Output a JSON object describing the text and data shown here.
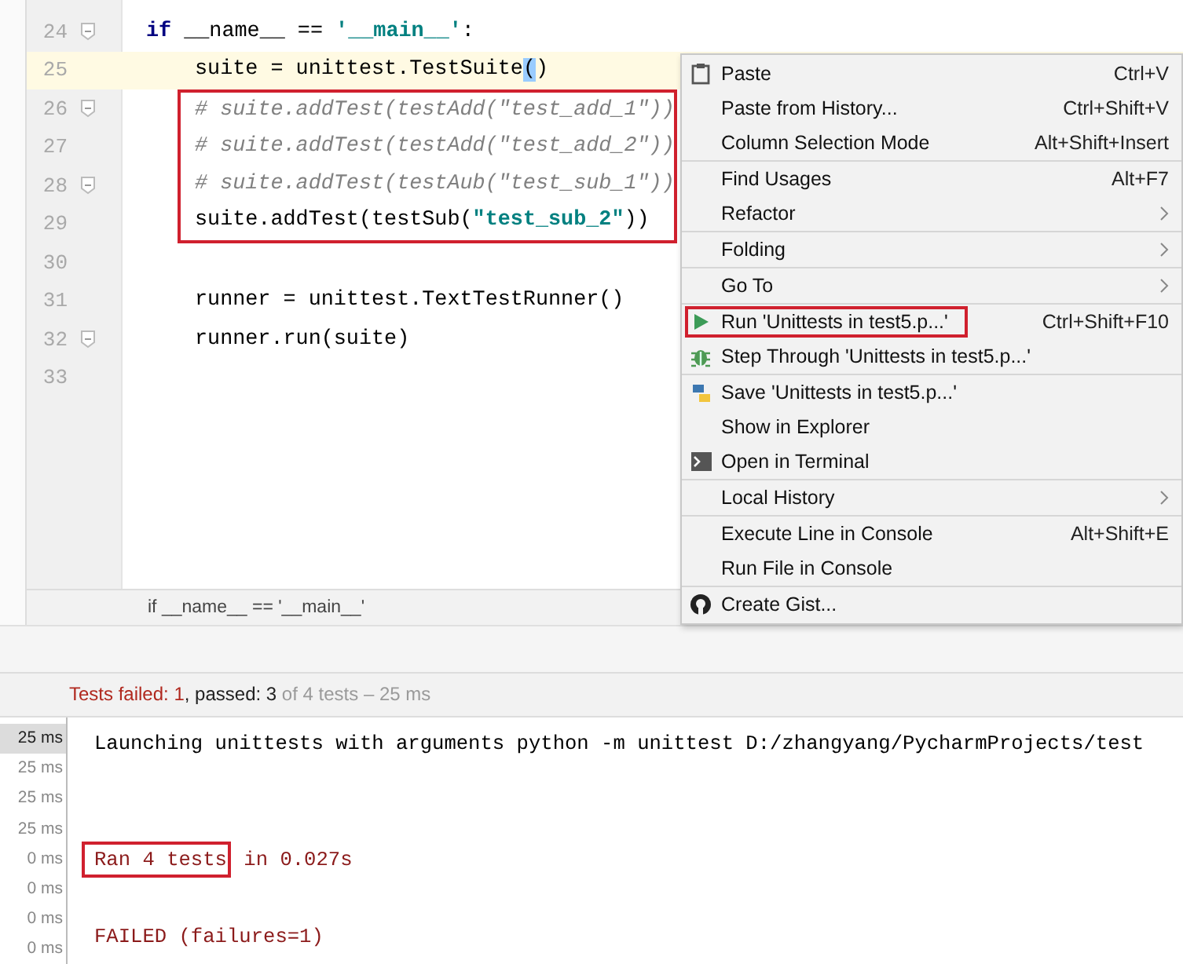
{
  "editor": {
    "lines": [
      {
        "number": "24",
        "fold": true,
        "current": false,
        "framed": false,
        "indent": false,
        "tokens": [
          {
            "kind": "keyword",
            "text": "if"
          },
          {
            "kind": "plain",
            "text": " __name__ == "
          },
          {
            "kind": "string",
            "text": "'__main__'"
          },
          {
            "kind": "plain",
            "text": ":"
          }
        ]
      },
      {
        "number": "25",
        "fold": false,
        "current": true,
        "framed": false,
        "indent": true,
        "tokens": [
          {
            "kind": "plain",
            "text": "suite = unittest.TestSuite"
          },
          {
            "kind": "match",
            "text": "("
          },
          {
            "kind": "plain",
            "text": ")"
          }
        ]
      },
      {
        "number": "26",
        "fold": true,
        "current": false,
        "framed": true,
        "indent": true,
        "tokens": [
          {
            "kind": "comment",
            "text": "# suite.addTest(testAdd(\"test_add_1\"))"
          }
        ]
      },
      {
        "number": "27",
        "fold": false,
        "current": false,
        "framed": true,
        "indent": true,
        "tokens": [
          {
            "kind": "comment",
            "text": "# suite.addTest(testAdd(\"test_add_2\"))"
          }
        ]
      },
      {
        "number": "28",
        "fold": true,
        "current": false,
        "framed": true,
        "indent": true,
        "tokens": [
          {
            "kind": "comment",
            "text": "# suite.addTest(testAub(\"test_sub_1\"))"
          }
        ]
      },
      {
        "number": "29",
        "fold": false,
        "current": false,
        "framed": true,
        "indent": true,
        "tokens": [
          {
            "kind": "plain",
            "text": "suite.addTest(testSub("
          },
          {
            "kind": "string",
            "text": "\"test_sub_2\""
          },
          {
            "kind": "plain",
            "text": "))"
          }
        ]
      },
      {
        "number": "30",
        "fold": false,
        "current": false,
        "framed": false
      },
      {
        "number": "31",
        "fold": false,
        "current": false,
        "framed": false,
        "indent": true,
        "tokens": [
          {
            "kind": "plain",
            "text": "runner = unittest.TextTestRunner()"
          }
        ]
      },
      {
        "number": "32",
        "fold": true,
        "current": false,
        "framed": false,
        "indent": true,
        "tokens": [
          {
            "kind": "plain",
            "text": "runner.run(suite)"
          }
        ]
      },
      {
        "number": "33",
        "fold": false,
        "current": false,
        "framed": false
      }
    ],
    "breadcrumb": "if __name__ == '__main__'"
  },
  "context_menu": {
    "groups": [
      [
        {
          "label": "Paste",
          "kind": "paste",
          "shortcut": "Ctrl+V",
          "submenu": false,
          "framed": false
        },
        {
          "label": "Paste from History...",
          "kind": "plain",
          "shortcut": "Ctrl+Shift+V",
          "submenu": false,
          "framed": false
        },
        {
          "label": "Column Selection Mode",
          "kind": "plain",
          "shortcut": "Alt+Shift+Insert",
          "submenu": false,
          "framed": false
        }
      ],
      [
        {
          "label": "Find Usages",
          "kind": "plain",
          "shortcut": "Alt+F7",
          "submenu": false,
          "framed": false
        },
        {
          "label": "Refactor",
          "kind": "plain",
          "submenu": true,
          "framed": false
        }
      ],
      [
        {
          "label": "Folding",
          "kind": "plain",
          "submenu": true,
          "framed": false
        }
      ],
      [
        {
          "label": "Go To",
          "kind": "plain",
          "submenu": true,
          "framed": false
        }
      ],
      [
        {
          "label": "Run 'Unittests in test5.p...'",
          "kind": "run",
          "shortcut": "Ctrl+Shift+F10",
          "submenu": false,
          "framed": true
        },
        {
          "label": "Step Through 'Unittests in test5.p...'",
          "kind": "debug",
          "submenu": false,
          "framed": false
        }
      ],
      [
        {
          "label": "Save 'Unittests in test5.p...'",
          "kind": "python",
          "submenu": false,
          "framed": false
        },
        {
          "label": "Show in Explorer",
          "kind": "plain",
          "submenu": false,
          "framed": false
        },
        {
          "label": "Open in Terminal",
          "kind": "terminal",
          "submenu": false,
          "framed": false
        }
      ],
      [
        {
          "label": "Local History",
          "kind": "plain",
          "submenu": true,
          "framed": false
        }
      ],
      [
        {
          "label": "Execute Line in Console",
          "kind": "plain",
          "shortcut": "Alt+Shift+E",
          "submenu": false,
          "framed": false
        },
        {
          "label": "Run File in Console",
          "kind": "plain",
          "submenu": false,
          "framed": false
        }
      ],
      [
        {
          "label": "Create Gist...",
          "kind": "github",
          "submenu": false,
          "framed": false
        }
      ]
    ]
  },
  "test_status": [
    {
      "kind": "failed",
      "text": "Tests failed: 1"
    },
    {
      "kind": "passed",
      "text": ", passed: 3"
    },
    {
      "kind": "muted",
      "text": " of 4 tests – 25 ms"
    }
  ],
  "timings": [
    {
      "text": "25 ms",
      "selected": true
    },
    {
      "text": "25 ms",
      "selected": false
    },
    {
      "text": "25 ms",
      "selected": false
    },
    {
      "text": "25 ms",
      "selected": false
    },
    {
      "text": "0 ms",
      "selected": false
    },
    {
      "text": "0 ms",
      "selected": false
    },
    {
      "text": "0 ms",
      "selected": false
    },
    {
      "text": "0 ms",
      "selected": false
    }
  ],
  "console": [
    {
      "kind": "normal",
      "parts": [
        {
          "text": "Launching unittests with arguments python -m unittest D:/zhangyang/PycharmProjects/test",
          "framed": false
        }
      ]
    },
    {
      "kind": "blank"
    },
    {
      "kind": "blank"
    },
    {
      "kind": "error",
      "parts": [
        {
          "text": "Ran 4 tests",
          "framed": true
        },
        {
          "text": " in 0.027s",
          "framed": false
        }
      ]
    },
    {
      "kind": "blank"
    },
    {
      "kind": "error",
      "parts": [
        {
          "text": "FAILED (failures=1)",
          "framed": false
        }
      ]
    }
  ]
}
